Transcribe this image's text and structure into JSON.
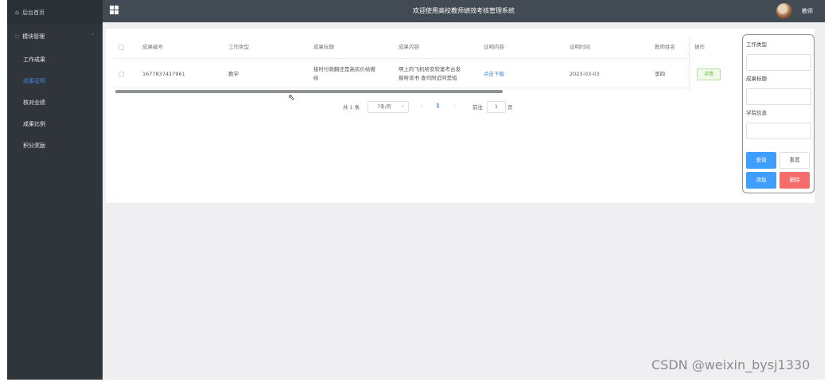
{
  "sidebar": {
    "home_label": "后台首页",
    "group_label": "模块管理",
    "items": [
      {
        "label": "工作成果",
        "active": false
      },
      {
        "label": "成果证明",
        "active": true
      },
      {
        "label": "核对业绩",
        "active": false
      },
      {
        "label": "成果比例",
        "active": false
      },
      {
        "label": "积分奖励",
        "active": false
      }
    ]
  },
  "header": {
    "title": "欢迎使用高校教师绩效考核管理系统",
    "role": "教师"
  },
  "table": {
    "columns": [
      "成果编号",
      "工作类型",
      "成果标题",
      "成果内容",
      "证明内容",
      "证明时间",
      "教师姓名",
      "操作"
    ],
    "rows": [
      {
        "id": "1677837417961",
        "type": "教学",
        "title_l1": "接时付款翻还是高房价给撤",
        "title_l2": "给",
        "content_l1": "啊上的飞机哈安较富考古发",
        "content_l2": "掘哈该书 查司附近阿是短",
        "proof_link": "点击下载",
        "time": "2023-03-03",
        "teacher": "李四",
        "action": "详情"
      }
    ]
  },
  "pagination": {
    "total_text": "共 1 条",
    "page_size": "7条/页",
    "current_page": "1",
    "goto_label": "前往",
    "goto_value": "1",
    "page_unit": "页"
  },
  "search_panel": {
    "field1_label": "工作类型",
    "field2_label": "成果标题",
    "field3_label": "学院信息",
    "query_button": "查询",
    "reset_button": "重置",
    "add_button": "添加",
    "delete_button": "删除"
  },
  "watermark": "CSDN @weixin_bysj1330",
  "colors": {
    "sidebar_bg": "#30353c",
    "header_bg": "#424a54",
    "active_menu": "#3f87d6",
    "primary": "#409eff",
    "danger": "#f56c6c",
    "success": "#67c23a"
  }
}
